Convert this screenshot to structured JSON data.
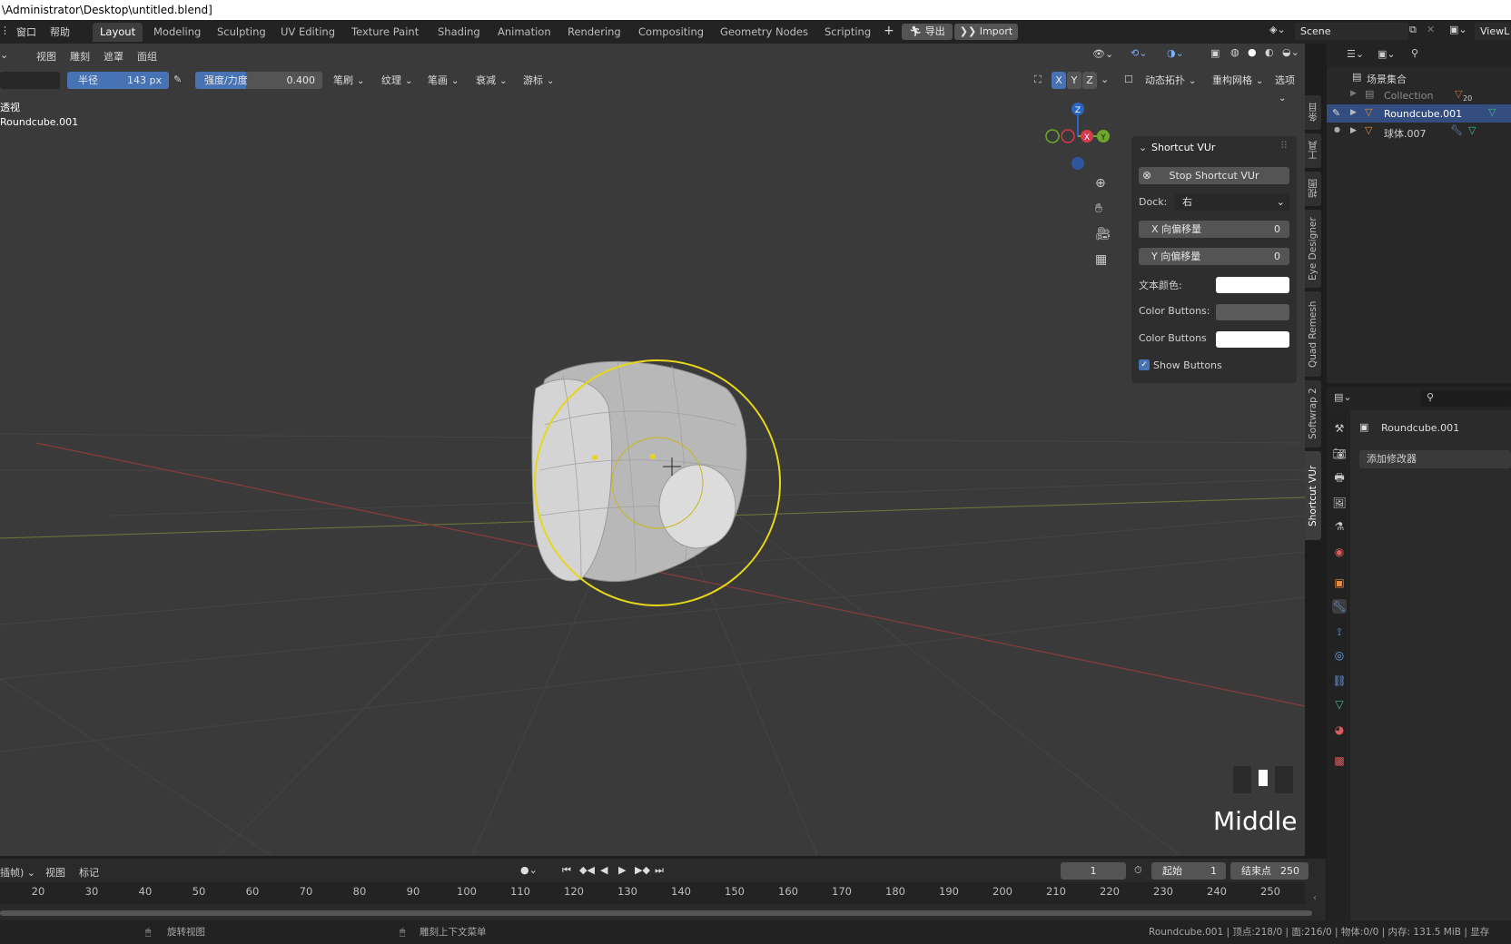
{
  "title_bar": {
    "text": "\\Administrator\\Desktop\\untitled.blend]"
  },
  "menu": {
    "window": "窗口",
    "help": "帮助"
  },
  "workspaces": [
    "Layout",
    "Modeling",
    "Sculpting",
    "UV Editing",
    "Texture Paint",
    "Shading",
    "Animation",
    "Rendering",
    "Compositing",
    "Geometry Nodes",
    "Scripting"
  ],
  "workspace_add": "+",
  "export_button": "导出",
  "import_button": "Import",
  "scene": {
    "name": "Scene",
    "viewlayer": "ViewL"
  },
  "viewport_menu": {
    "view": "视图",
    "sculpt": "雕刻",
    "mask": "遮罩",
    "face_sets": "面组"
  },
  "tool_header": {
    "radius_label": "半径",
    "radius_value": "143 px",
    "strength_label": "强度/力度",
    "strength_value": "0.400",
    "brush": "笔刷",
    "texture": "纹理",
    "stroke": "笔画",
    "falloff": "衰减",
    "cursor": "游标",
    "x": "X",
    "y": "Y",
    "z": "Z",
    "dyntopo": "动态拓扑",
    "remesh": "重构网格",
    "options": "选项"
  },
  "overlay_text": {
    "view_name": "透视",
    "object_name": "Roundcube.001"
  },
  "gizmo": {
    "z": "Z",
    "x": "X",
    "y": "Y"
  },
  "shortcut_panel": {
    "title": "Shortcut VUr",
    "stop_button": "Stop Shortcut VUr",
    "dock_label": "Dock:",
    "dock_value": "右",
    "x_offset_label": "X 向偏移量",
    "x_offset_value": "0",
    "y_offset_label": "Y 向偏移量",
    "y_offset_value": "0",
    "text_color_label": "文本颜色:",
    "text_color": "#ffffff",
    "color_buttons_label_1": "Color Buttons:",
    "color_buttons_1": "#5a5a5a",
    "color_buttons_label_2": "Color Buttons",
    "color_buttons_2": "#ffffff",
    "show_buttons_label": "Show Buttons",
    "show_buttons_checked": true
  },
  "mouse_indicator": {
    "label": "Middle"
  },
  "side_tabs": [
    "条目",
    "工具",
    "视图",
    "Eye Designer",
    "Quad Remesh",
    "Softwrap 2",
    "Shortcut VUr"
  ],
  "outliner": {
    "scene_collection": "场景集合",
    "collection": "Collection",
    "collection_badge": "20",
    "items": [
      "Roundcube.001",
      "球体.007"
    ]
  },
  "properties": {
    "object_name": "Roundcube.001",
    "add_modifier": "添加修改器"
  },
  "timeline": {
    "mode": "插帧)",
    "view": "视图",
    "marker": "标记",
    "current_frame": "1",
    "start_label": "起始",
    "start_value": "1",
    "end_label": "结束点",
    "end_value": "250",
    "ticks": [
      "20",
      "30",
      "40",
      "50",
      "60",
      "70",
      "80",
      "90",
      "100",
      "110",
      "120",
      "130",
      "140",
      "150",
      "160",
      "170",
      "180",
      "190",
      "200",
      "210",
      "220",
      "230",
      "240",
      "250"
    ]
  },
  "statusbar": {
    "rotate_view": "旋转视图",
    "sculpt_menu": "雕刻上下文菜单",
    "stats": "Roundcube.001 | 顶点:218/0 | 面:216/0 | 物体:0/0 | 内存: 131.5 MiB | 显存"
  },
  "colors": {
    "accent_blue": "#4772b3",
    "brush_circle": "#e8d61a",
    "selected_row": "#334d80"
  }
}
